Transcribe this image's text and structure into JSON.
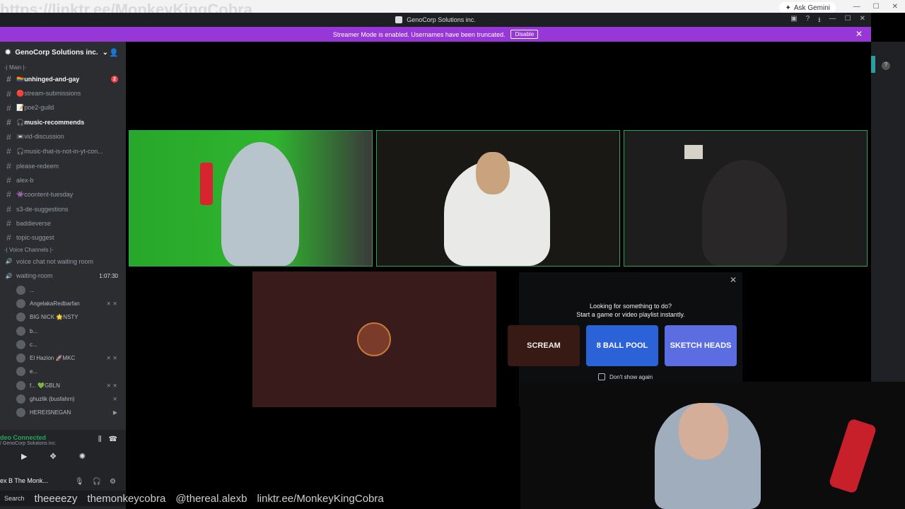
{
  "browser": {
    "ask_label": "Ask Gemini"
  },
  "overlay": {
    "top_link": "https://linktr.ee/MonkeyKingCobra",
    "ticker": [
      "theeeezy",
      "themonkeycobra",
      "@thereal.alexb",
      "linktr.ee/MonkeyKingCobra"
    ]
  },
  "titlebar": {
    "title": "GenoCorp Solutions inc."
  },
  "streamer_banner": {
    "text": "Streamer Mode is enabled. Usernames have been truncated.",
    "button": "Disable"
  },
  "server": {
    "name": "GenoCorp Solutions inc.",
    "main_category": "-| Main |-",
    "voice_category": "-| Voice Channels |-"
  },
  "channels": [
    {
      "name": "🏳️‍🌈unhinged-and-gay",
      "bold": true,
      "badge": "2"
    },
    {
      "name": "🔴stream-submissions",
      "bold": false
    },
    {
      "name": "📝poe2-guild",
      "bold": false
    },
    {
      "name": "🎧music-recommends",
      "bold": true
    },
    {
      "name": "📼vid-discussion",
      "bold": false
    },
    {
      "name": "🎧music-that-is-not-in-yt-con...",
      "bold": false
    },
    {
      "name": "please-redeem",
      "bold": false
    },
    {
      "name": "alex-b",
      "bold": false
    },
    {
      "name": "👾coontent-tuesday",
      "bold": false
    },
    {
      "name": "s3-de-suggestions",
      "bold": false
    },
    {
      "name": "baddieverse",
      "bold": false
    },
    {
      "name": "topic-suggest",
      "bold": false
    }
  ],
  "voice_channels": [
    {
      "name": "voice chat not waiting room"
    },
    {
      "name": "waiting-room",
      "timer": "1:07:30"
    }
  ],
  "voice_users": [
    {
      "name": "...",
      "icons": ""
    },
    {
      "name": "AngelakaRedbarfan",
      "icons": "⨯ ⨯"
    },
    {
      "name": "BIG NICK 🌟NSTY",
      "icons": ""
    },
    {
      "name": "b...",
      "icons": ""
    },
    {
      "name": "c...",
      "icons": ""
    },
    {
      "name": "El Hazion 🚀MKC",
      "icons": "⨯ ⨯"
    },
    {
      "name": "e...",
      "icons": ""
    },
    {
      "name": "f... 💚GBLN",
      "icons": "⨯ ⨯"
    },
    {
      "name": "ghuzlik (busfahrn)",
      "icons": "⨯"
    },
    {
      "name": "HEREISNEGAN",
      "icons": "▶"
    }
  ],
  "voice_bar": {
    "status": "deo Connected",
    "server": "/ GenoCorp Solutions inc."
  },
  "user_panel": {
    "name": "ex B The Monk..."
  },
  "activity": {
    "line1": "Looking for something to do?",
    "line2": "Start a game or video playlist instantly.",
    "cards": [
      "SCREAM",
      "8 BALL POOL",
      "SKETCH HEADS"
    ],
    "dont_show": "Don't show again"
  },
  "taskbar": {
    "search": "Search"
  }
}
